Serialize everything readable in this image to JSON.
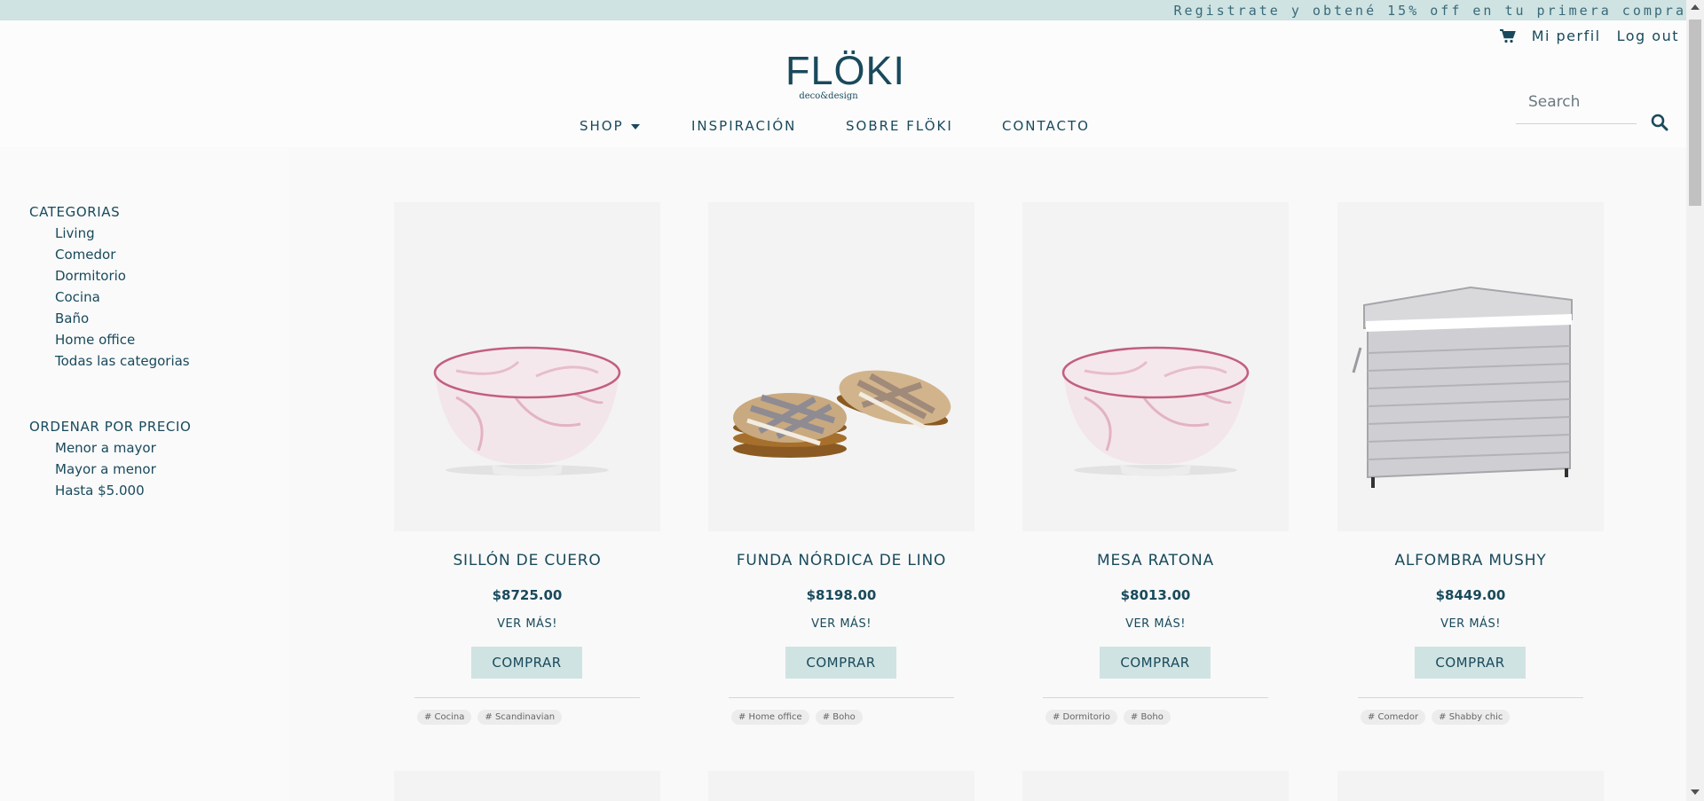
{
  "promo": {
    "text": "Registrate y obtené 15% off en tu primera compra"
  },
  "utils": {
    "cart_icon": "cart-icon",
    "profile": "Mi perfil",
    "logout": "Log out"
  },
  "logo": {
    "brand": "FLÖKI",
    "tagline": "deco&design"
  },
  "nav": {
    "shop": "SHOP",
    "inspiracion": "INSPIRACIÓN",
    "sobre": "SOBRE FLÖKI",
    "contacto": "CONTACTO"
  },
  "search": {
    "placeholder": "Search",
    "icon": "search-icon"
  },
  "filters": {
    "categories_title": "CATEGORIAS",
    "categories": [
      "Living",
      "Comedor",
      "Dormitorio",
      "Cocina",
      "Baño",
      "Home office",
      "Todas las categorias"
    ],
    "price_title": "ORDENAR POR PRECIO",
    "price_options": [
      "Menor a mayor",
      "Mayor a menor",
      "Hasta $5.000"
    ]
  },
  "products": [
    {
      "name": "SILLÓN DE CUERO",
      "price": "$8725.00",
      "more": "VER MÁS!",
      "buy": "COMPRAR",
      "image": "pink-marble-bowl",
      "tags": [
        "# Cocina",
        "# Scandinavian"
      ]
    },
    {
      "name": "FUNDA NÓRDICA DE LINO",
      "price": "$8198.00",
      "more": "VER MÁS!",
      "buy": "COMPRAR",
      "image": "wooden-coasters",
      "tags": [
        "# Home office",
        "# Boho"
      ]
    },
    {
      "name": "MESA RATONA",
      "price": "$8013.00",
      "more": "VER MÁS!",
      "buy": "COMPRAR",
      "image": "pink-marble-bowl",
      "tags": [
        "# Dormitorio",
        "# Boho"
      ]
    },
    {
      "name": "ALFOMBRA MUSHY",
      "price": "$8449.00",
      "more": "VER MÁS!",
      "buy": "COMPRAR",
      "image": "wicker-storage-trunk",
      "tags": [
        "# Comedor",
        "# Shabby chic"
      ]
    }
  ],
  "colors": {
    "primary": "#194a5c",
    "accent": "#cfe3e2",
    "background": "#fafafa"
  }
}
